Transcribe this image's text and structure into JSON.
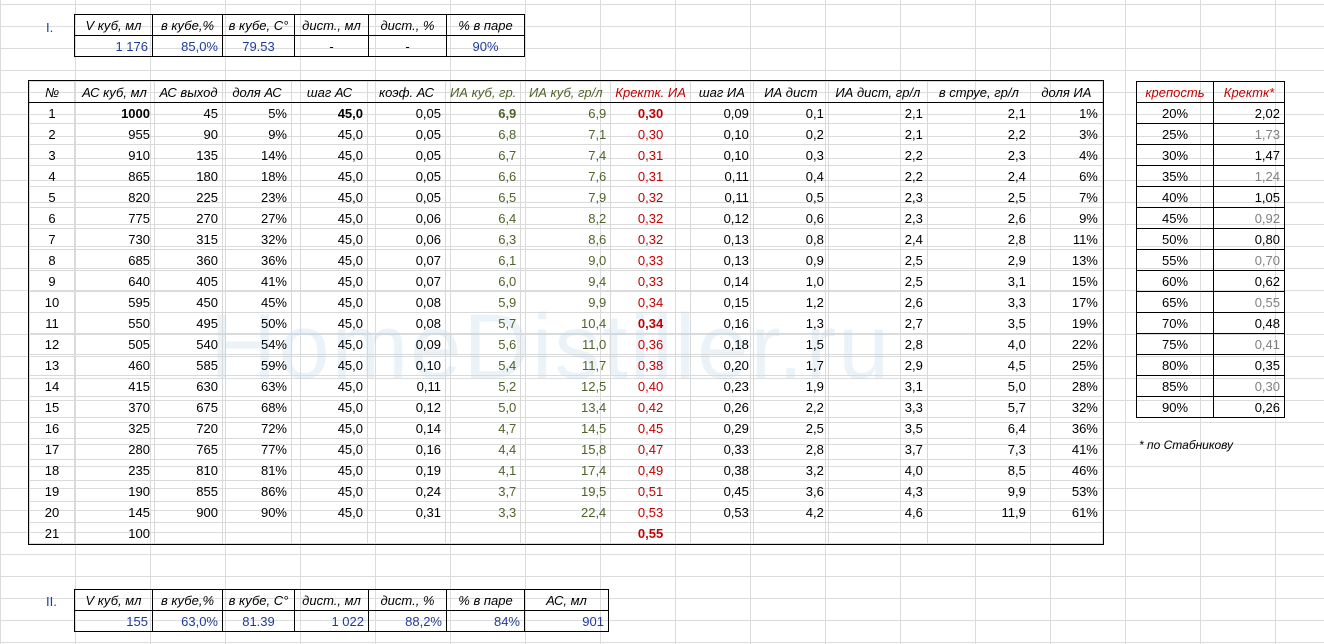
{
  "watermark": "HomeDistiller.ru",
  "section1": {
    "label": "I.",
    "headers": [
      "V куб, мл",
      "в кубе,%",
      "в кубе, С°",
      "дист., мл",
      "дист., %",
      "% в паре"
    ],
    "values": [
      "1 176",
      "85,0%",
      "79.53",
      "-",
      "-",
      "90%"
    ]
  },
  "main": {
    "headers": [
      "№",
      "АС куб, мл",
      "АС выход",
      "доля АС",
      "шаг АС",
      "коэф. АС",
      "ИА куб, гр.",
      "ИА куб, гр/л",
      "Кректк. ИА",
      "шаг ИА",
      "ИА дист",
      "ИА дист, гр/л",
      "в струе, гр/л",
      "доля ИА"
    ],
    "rows": [
      [
        "1",
        "1000",
        "45",
        "5%",
        "45,0",
        "0,05",
        "6,9",
        "6,9",
        "0,30",
        "0,09",
        "0,1",
        "2,1",
        "2,1",
        "1%"
      ],
      [
        "2",
        "955",
        "90",
        "9%",
        "45,0",
        "0,05",
        "6,8",
        "7,1",
        "0,30",
        "0,10",
        "0,2",
        "2,1",
        "2,2",
        "3%"
      ],
      [
        "3",
        "910",
        "135",
        "14%",
        "45,0",
        "0,05",
        "6,7",
        "7,4",
        "0,31",
        "0,10",
        "0,3",
        "2,2",
        "2,3",
        "4%"
      ],
      [
        "4",
        "865",
        "180",
        "18%",
        "45,0",
        "0,05",
        "6,6",
        "7,6",
        "0,31",
        "0,11",
        "0,4",
        "2,2",
        "2,4",
        "6%"
      ],
      [
        "5",
        "820",
        "225",
        "23%",
        "45,0",
        "0,05",
        "6,5",
        "7,9",
        "0,32",
        "0,11",
        "0,5",
        "2,3",
        "2,5",
        "7%"
      ],
      [
        "6",
        "775",
        "270",
        "27%",
        "45,0",
        "0,06",
        "6,4",
        "8,2",
        "0,32",
        "0,12",
        "0,6",
        "2,3",
        "2,6",
        "9%"
      ],
      [
        "7",
        "730",
        "315",
        "32%",
        "45,0",
        "0,06",
        "6,3",
        "8,6",
        "0,32",
        "0,13",
        "0,8",
        "2,4",
        "2,8",
        "11%"
      ],
      [
        "8",
        "685",
        "360",
        "36%",
        "45,0",
        "0,07",
        "6,1",
        "9,0",
        "0,33",
        "0,13",
        "0,9",
        "2,5",
        "2,9",
        "13%"
      ],
      [
        "9",
        "640",
        "405",
        "41%",
        "45,0",
        "0,07",
        "6,0",
        "9,4",
        "0,33",
        "0,14",
        "1,0",
        "2,5",
        "3,1",
        "15%"
      ],
      [
        "10",
        "595",
        "450",
        "45%",
        "45,0",
        "0,08",
        "5,9",
        "9,9",
        "0,34",
        "0,15",
        "1,2",
        "2,6",
        "3,3",
        "17%"
      ],
      [
        "11",
        "550",
        "495",
        "50%",
        "45,0",
        "0,08",
        "5,7",
        "10,4",
        "0,34",
        "0,16",
        "1,3",
        "2,7",
        "3,5",
        "19%"
      ],
      [
        "12",
        "505",
        "540",
        "54%",
        "45,0",
        "0,09",
        "5,6",
        "11,0",
        "0,36",
        "0,18",
        "1,5",
        "2,8",
        "4,0",
        "22%"
      ],
      [
        "13",
        "460",
        "585",
        "59%",
        "45,0",
        "0,10",
        "5,4",
        "11,7",
        "0,38",
        "0,20",
        "1,7",
        "2,9",
        "4,5",
        "25%"
      ],
      [
        "14",
        "415",
        "630",
        "63%",
        "45,0",
        "0,11",
        "5,2",
        "12,5",
        "0,40",
        "0,23",
        "1,9",
        "3,1",
        "5,0",
        "28%"
      ],
      [
        "15",
        "370",
        "675",
        "68%",
        "45,0",
        "0,12",
        "5,0",
        "13,4",
        "0,42",
        "0,26",
        "2,2",
        "3,3",
        "5,7",
        "32%"
      ],
      [
        "16",
        "325",
        "720",
        "72%",
        "45,0",
        "0,14",
        "4,7",
        "14,5",
        "0,45",
        "0,29",
        "2,5",
        "3,5",
        "6,4",
        "36%"
      ],
      [
        "17",
        "280",
        "765",
        "77%",
        "45,0",
        "0,16",
        "4,4",
        "15,8",
        "0,47",
        "0,33",
        "2,8",
        "3,7",
        "7,3",
        "41%"
      ],
      [
        "18",
        "235",
        "810",
        "81%",
        "45,0",
        "0,19",
        "4,1",
        "17,4",
        "0,49",
        "0,38",
        "3,2",
        "4,0",
        "8,5",
        "46%"
      ],
      [
        "19",
        "190",
        "855",
        "86%",
        "45,0",
        "0,24",
        "3,7",
        "19,5",
        "0,51",
        "0,45",
        "3,6",
        "4,3",
        "9,9",
        "53%"
      ],
      [
        "20",
        "145",
        "900",
        "90%",
        "45,0",
        "0,31",
        "3,3",
        "22,4",
        "0,53",
        "0,53",
        "4,2",
        "4,6",
        "11,9",
        "61%"
      ],
      [
        "21",
        "100",
        "",
        "",
        "",
        "",
        "",
        "",
        "0,55",
        "",
        "",
        "",
        "",
        ""
      ]
    ]
  },
  "krepost": {
    "headers": [
      "крепость",
      "Кректк*"
    ],
    "rows": [
      [
        "20%",
        "2,02"
      ],
      [
        "25%",
        "1,73"
      ],
      [
        "30%",
        "1,47"
      ],
      [
        "35%",
        "1,24"
      ],
      [
        "40%",
        "1,05"
      ],
      [
        "45%",
        "0,92"
      ],
      [
        "50%",
        "0,80"
      ],
      [
        "55%",
        "0,70"
      ],
      [
        "60%",
        "0,62"
      ],
      [
        "65%",
        "0,55"
      ],
      [
        "70%",
        "0,48"
      ],
      [
        "75%",
        "0,41"
      ],
      [
        "80%",
        "0,35"
      ],
      [
        "85%",
        "0,30"
      ],
      [
        "90%",
        "0,26"
      ]
    ],
    "footnote": "* по Стабникову"
  },
  "section2": {
    "label": "II.",
    "headers": [
      "V куб, мл",
      "в кубе,%",
      "в кубе, С°",
      "дист., мл",
      "дист., %",
      "% в паре",
      "АС, мл"
    ],
    "values": [
      "155",
      "63,0%",
      "81.39",
      "1 022",
      "88,2%",
      "84%",
      "901"
    ]
  },
  "colors": {
    "blue": "#1f3c99",
    "green": "#4f6228",
    "red": "#c00000",
    "gray": "#808080"
  }
}
